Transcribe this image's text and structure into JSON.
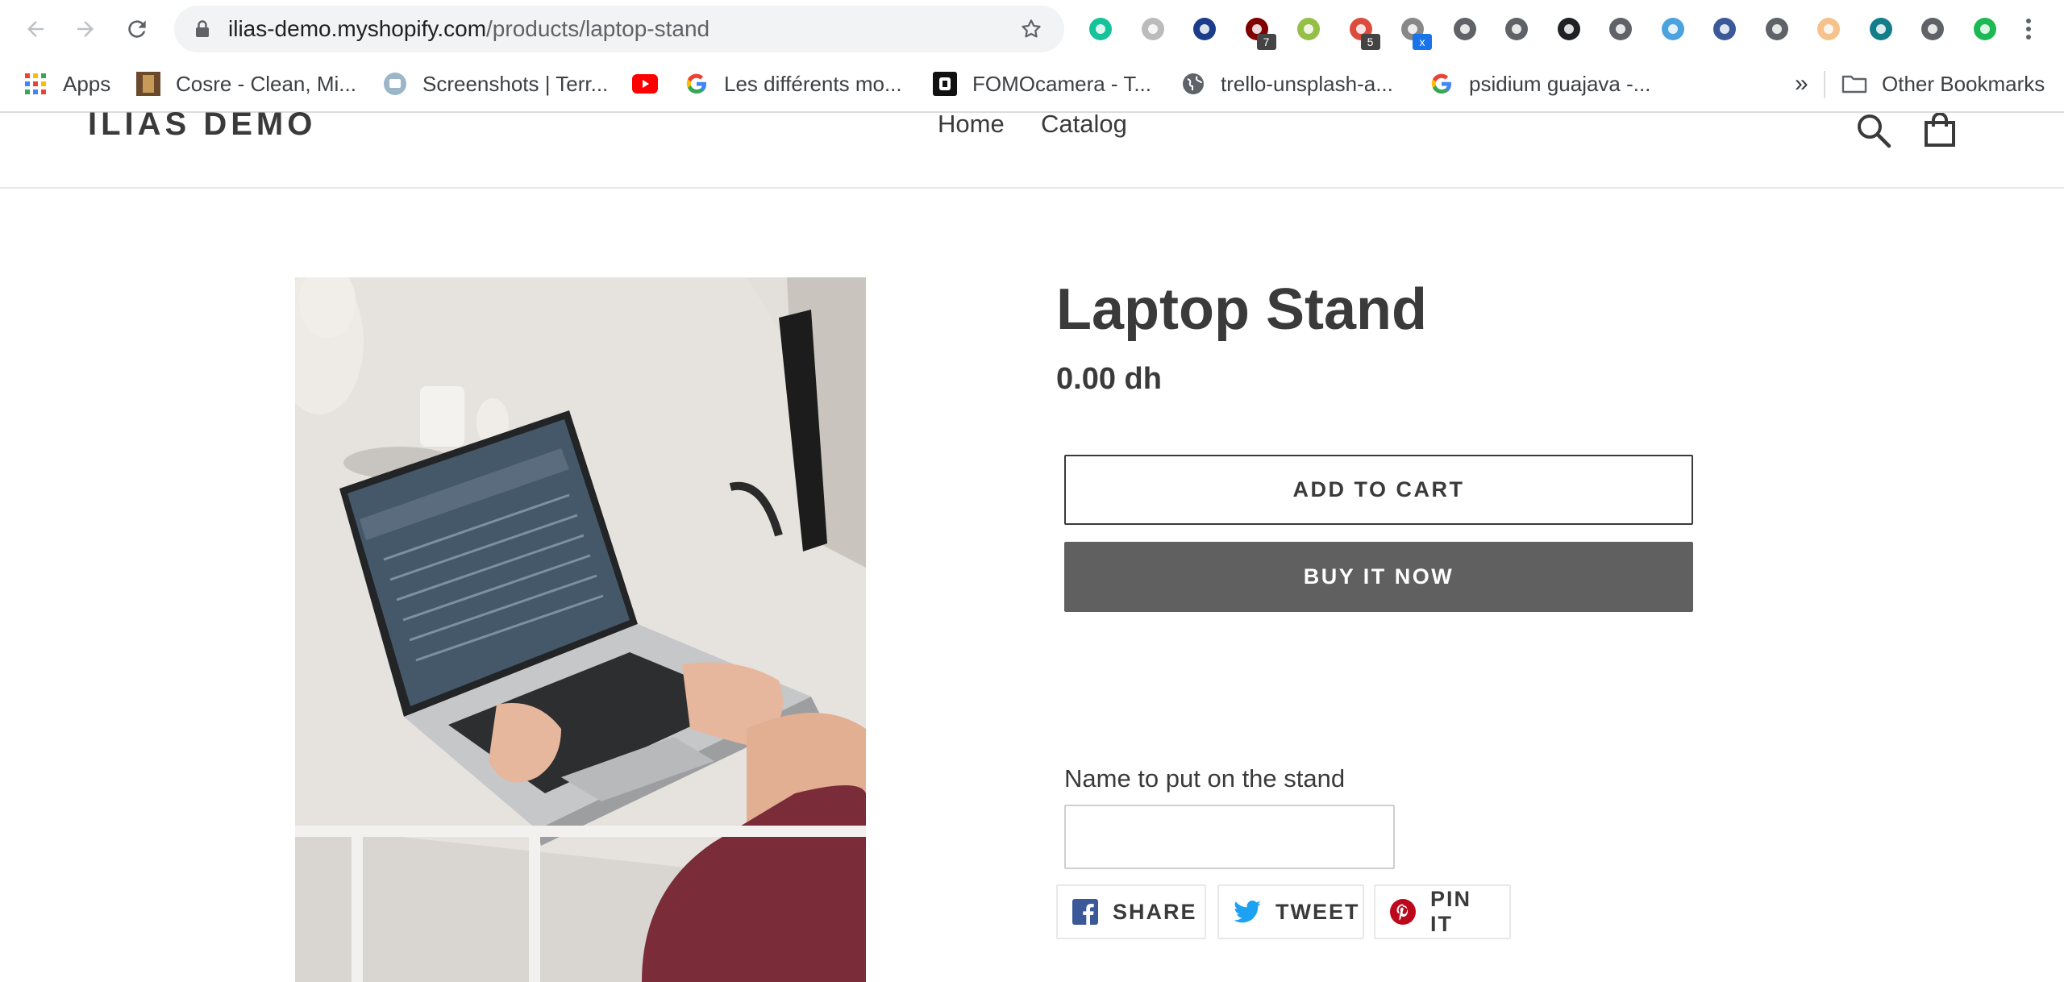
{
  "browser": {
    "url_host": "ilias-demo.myshopify.com",
    "url_path": "/products/laptop-stand",
    "extensions": [
      {
        "name": "grammarly-icon",
        "badge": "",
        "color": "#15c39a"
      },
      {
        "name": "react-devtools-icon",
        "badge": "",
        "color": "#bbbbbb"
      },
      {
        "name": "vimeo-v-icon",
        "badge": "",
        "color": "#1a3c8a"
      },
      {
        "name": "ublock-icon",
        "badge": "7",
        "color": "#800000"
      },
      {
        "name": "shopify-icon",
        "badge": "",
        "color": "#95bf47"
      },
      {
        "name": "todoist-icon",
        "badge": "5",
        "color": "#db4c3f"
      },
      {
        "name": "clockify-icon",
        "badge": "x",
        "color": "#888888"
      },
      {
        "name": "lines-icon",
        "badge": "",
        "color": "#5f6368"
      },
      {
        "name": "history-icon",
        "badge": "",
        "color": "#5f6368"
      },
      {
        "name": "medium-lock-icon",
        "badge": "",
        "color": "#202124"
      },
      {
        "name": "cloud-icon",
        "badge": "",
        "color": "#5f6368"
      },
      {
        "name": "search-ext-icon",
        "badge": "",
        "color": "#4aa3df"
      },
      {
        "name": "swirl-icon",
        "badge": "",
        "color": "#3b5998"
      },
      {
        "name": "eyedropper-icon",
        "badge": "",
        "color": "#5f6368"
      },
      {
        "name": "avatar-ext-icon",
        "badge": "",
        "color": "#f4c28a"
      },
      {
        "name": "bars-icon",
        "badge": "",
        "color": "#137e8a"
      },
      {
        "name": "puzzle-icon",
        "badge": "",
        "color": "#5f6368"
      },
      {
        "name": "profile-chip-icon",
        "badge": "",
        "color": "#1db954"
      }
    ]
  },
  "bookmarks": [
    {
      "label": "Apps",
      "icon": "apps-grid-icon"
    },
    {
      "label": "Cosre - Clean, Mi...",
      "icon": "cosre-icon"
    },
    {
      "label": "Screenshots | Terr...",
      "icon": "screenshots-icon"
    },
    {
      "label": "",
      "icon": "youtube-icon"
    },
    {
      "label": "Les différents mo...",
      "icon": "google-icon"
    },
    {
      "label": "FOMOcamera - T...",
      "icon": "fomo-icon"
    },
    {
      "label": "trello-unsplash-a...",
      "icon": "globe-icon"
    },
    {
      "label": "psidium guajava -...",
      "icon": "google-icon"
    }
  ],
  "bookmarks_overflow": "»",
  "other_bookmarks": "Other Bookmarks",
  "store": {
    "logo": "ILIAS DEMO",
    "nav": [
      "Home",
      "Catalog"
    ]
  },
  "product": {
    "title": "Laptop Stand",
    "price": "0.00 dh",
    "add_to_cart": "ADD TO CART",
    "buy_now": "BUY IT NOW",
    "custom_field_label": "Name to put on the stand",
    "custom_field_value": ""
  },
  "share": {
    "facebook": "SHARE",
    "twitter": "TWEET",
    "pinterest": "PIN IT"
  },
  "colors": {
    "text": "#3a3a3a",
    "buy_button": "#606060",
    "facebook": "#3b5998",
    "twitter": "#1da1f2",
    "pinterest": "#bd081c"
  }
}
